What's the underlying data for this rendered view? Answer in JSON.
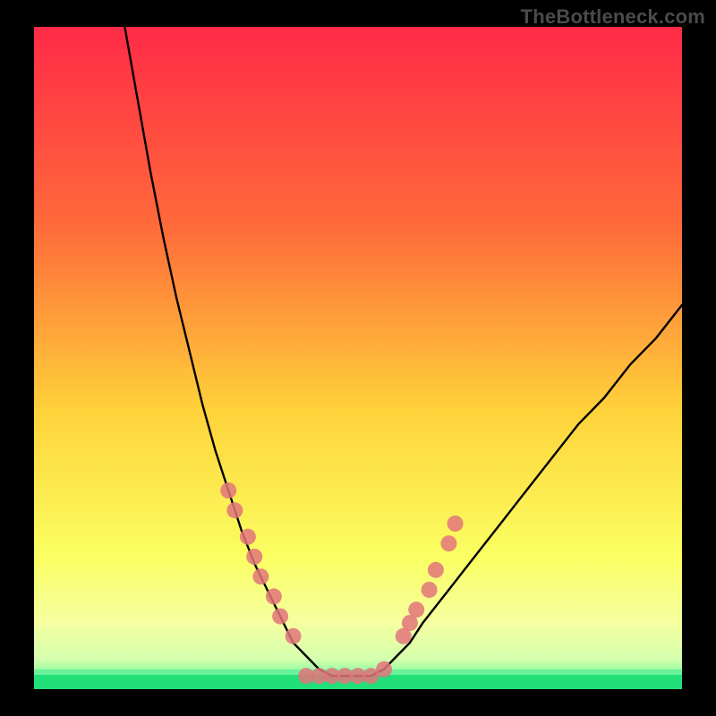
{
  "watermark": "TheBottleneck.com",
  "chart_data": {
    "type": "line",
    "title": "",
    "xlabel": "",
    "ylabel": "",
    "xlim": [
      0,
      100
    ],
    "ylim": [
      0,
      100
    ],
    "grid": false,
    "notes": "Heat-map style gradient background (red→orange→yellow→green) with a black U-shaped curve; pink dots highlight sampled points on both flanks and along the trough. Axes are unlabeled so x/y are normalized 0–100.",
    "background_gradient": [
      "#ff2a47",
      "#ff6a3a",
      "#ffd23a",
      "#faff62",
      "#3dfb8f"
    ],
    "series": [
      {
        "name": "curve",
        "style": "line",
        "color": "#000000",
        "x": [
          14,
          16,
          18,
          20,
          22,
          24,
          26,
          28,
          30,
          32,
          34,
          36,
          38,
          40,
          42,
          44,
          46,
          48,
          50,
          52,
          54,
          56,
          58,
          60,
          64,
          68,
          72,
          76,
          80,
          84,
          88,
          92,
          96,
          100
        ],
        "y": [
          100,
          89,
          78,
          68,
          59,
          51,
          43,
          36,
          30,
          24,
          19,
          15,
          11,
          7,
          5,
          3,
          2,
          2,
          2,
          2,
          3,
          5,
          7,
          10,
          15,
          20,
          25,
          30,
          35,
          40,
          44,
          49,
          53,
          58
        ]
      },
      {
        "name": "samples-left-flank",
        "style": "scatter",
        "color": "#e2747a",
        "x": [
          30,
          31,
          33,
          34,
          35,
          37,
          38,
          40
        ],
        "y": [
          30,
          27,
          23,
          20,
          17,
          14,
          11,
          8
        ]
      },
      {
        "name": "samples-right-flank",
        "style": "scatter",
        "color": "#e2747a",
        "x": [
          57,
          58,
          59,
          61,
          62,
          64,
          65
        ],
        "y": [
          8,
          10,
          12,
          15,
          18,
          22,
          25
        ]
      },
      {
        "name": "samples-trough",
        "style": "scatter",
        "color": "#e2747a",
        "x": [
          42,
          44,
          46,
          48,
          50,
          52,
          54
        ],
        "y": [
          2,
          2,
          2,
          2,
          2,
          2,
          3
        ]
      }
    ]
  }
}
